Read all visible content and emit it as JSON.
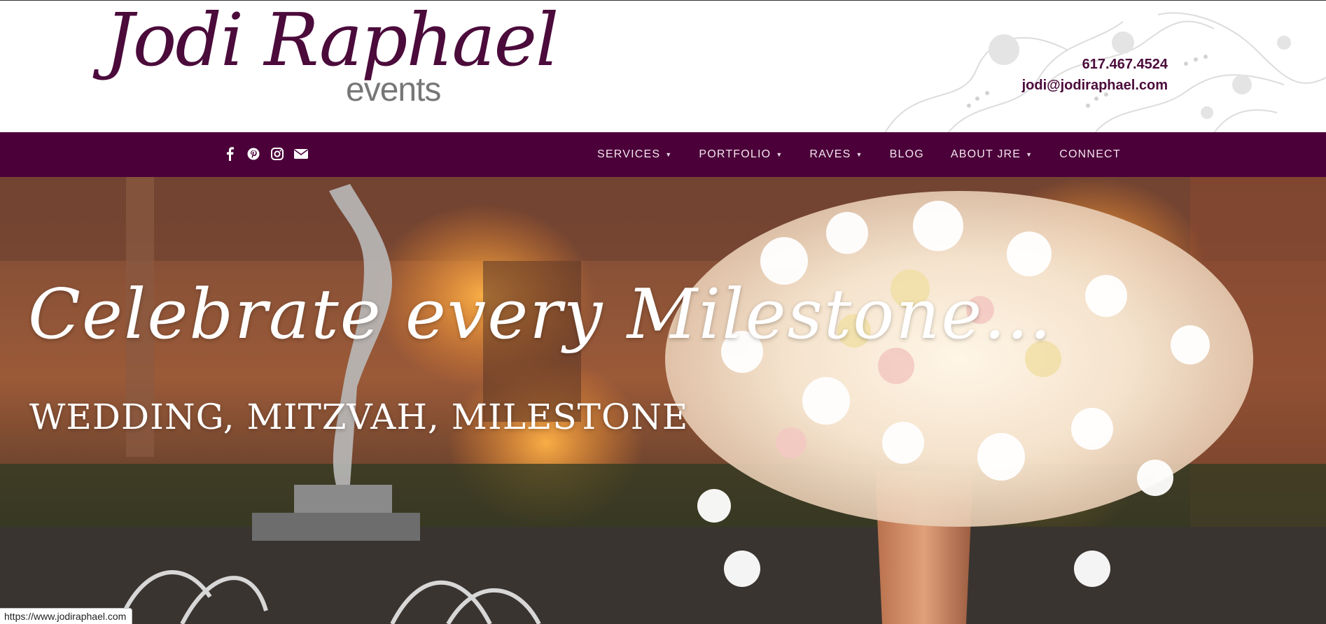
{
  "brand": {
    "logo_script": "Jodi Raphael",
    "logo_sub": "events"
  },
  "contact": {
    "phone": "617.467.4524",
    "email": "jodi@jodiraphael.com"
  },
  "social": {
    "icons": [
      "facebook-icon",
      "pinterest-icon",
      "instagram-icon",
      "envelope-icon"
    ]
  },
  "nav": {
    "items": [
      {
        "label": "SERVICES",
        "dropdown": true
      },
      {
        "label": "PORTFOLIO",
        "dropdown": true
      },
      {
        "label": "RAVES",
        "dropdown": true
      },
      {
        "label": "BLOG",
        "dropdown": false
      },
      {
        "label": "ABOUT JRE",
        "dropdown": true
      },
      {
        "label": "CONNECT",
        "dropdown": false
      }
    ]
  },
  "hero": {
    "title": "Celebrate every Milestone…",
    "subtitle": "WEDDING, MITZVAH, MILESTONE"
  },
  "status_bar": {
    "url": "https://www.jodiraphael.com"
  },
  "colors": {
    "brand_plum": "#4b0039",
    "logo_plum": "#4b0b3b",
    "logo_grey": "#777777",
    "nav_text": "#f3e6ee"
  }
}
